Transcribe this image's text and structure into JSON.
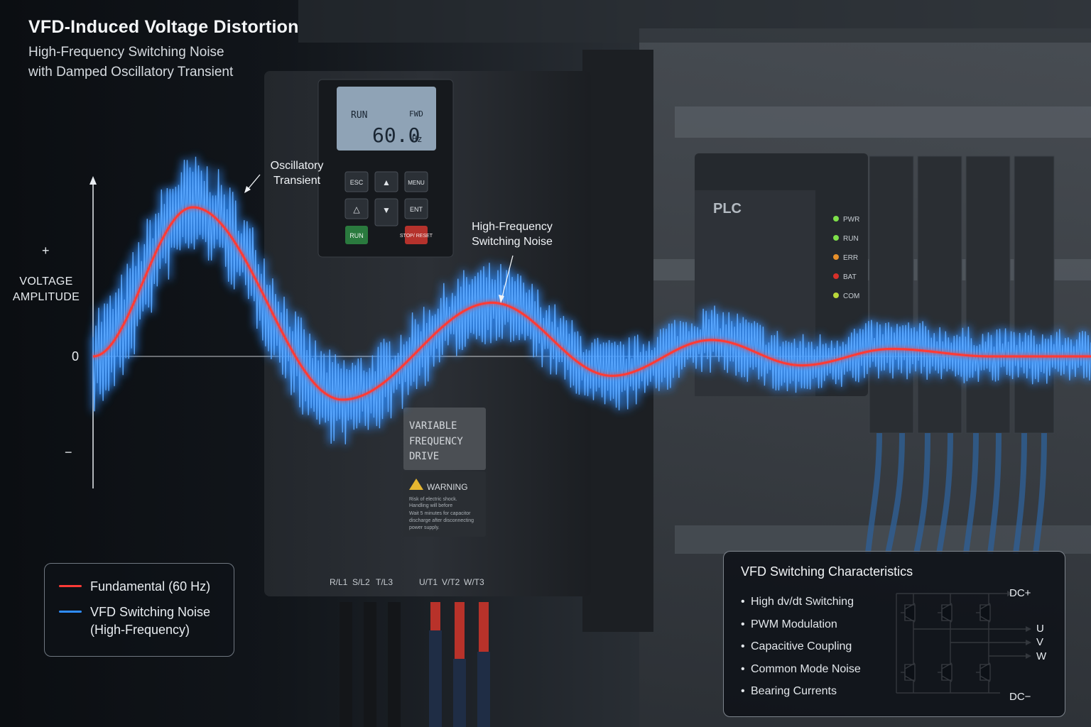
{
  "title": "VFD-Induced Voltage Distortion",
  "subtitle_line1": "High-Frequency Switching Noise",
  "subtitle_line2": "with Damped Oscillatory Transient",
  "colors": {
    "fundamental": "#ff3b36",
    "noise": "#2f8dff",
    "background": "#0c0f13"
  },
  "chart_data": {
    "type": "line",
    "title": "VFD-Induced Voltage Distortion",
    "ylabel_line1": "VOLTAGE",
    "ylabel_line2": "AMPLITUDE",
    "xlabel": "",
    "yticks": [
      "+",
      "0",
      "−"
    ],
    "ylim": [
      -1.3,
      1.3
    ],
    "description_values": {
      "fundamental_peaks": [
        {
          "t": 0.1,
          "v": 1.0
        },
        {
          "t": 0.25,
          "v": -0.29
        },
        {
          "t": 0.4,
          "v": 0.36
        },
        {
          "t": 0.52,
          "v": -0.13
        },
        {
          "t": 0.62,
          "v": 0.11
        },
        {
          "t": 0.71,
          "v": -0.06
        },
        {
          "t": 0.8,
          "v": 0.05
        }
      ]
    },
    "series": [
      {
        "name": "Fundamental (60 Hz)"
      },
      {
        "name": "VFD Switching Noise (High-Frequency)"
      }
    ],
    "legend_position": "bottom-left",
    "grid": false
  },
  "annotations": {
    "transient_line1": "Oscillatory",
    "transient_line2": "Transient",
    "noise_line1": "High-Frequency",
    "noise_line2": "Switching Noise"
  },
  "legend": {
    "item1": "Fundamental (60 Hz)",
    "item2_line1": "VFD Switching Noise",
    "item2_line2": "(High-Frequency)"
  },
  "panel": {
    "title": "VFD Switching Characteristics",
    "items": [
      "High dv/dt Switching",
      "PWM Modulation",
      "Capacitive Coupling",
      "Common Mode Noise",
      "Bearing Currents"
    ],
    "circuit_labels": {
      "dc_plus": "DC+",
      "u": "U",
      "v": "V",
      "w": "W",
      "dc_minus": "DC−"
    }
  },
  "vfd": {
    "display_mode": "RUN",
    "display_dir": "FWD",
    "display_value": "60.0",
    "display_unit": "Hz",
    "keys": [
      "ESC",
      "▲",
      "MENU",
      "△",
      "▼",
      "ENT",
      "RUN",
      "STOP/ RESET"
    ],
    "label_lines": [
      "VARIABLE",
      "FREQUENCY",
      "DRIVE"
    ],
    "warning": "WARNING",
    "warning_body": [
      "Risk of electric shock.",
      "Handling will before",
      "Wait 5 minutes for capacitor",
      "discharge after disconnecting",
      "power supply."
    ],
    "terminals": [
      "R/L1",
      "S/L2",
      "T/L3",
      "U/T1",
      "V/T2",
      "W/T3"
    ]
  },
  "plc": {
    "label": "PLC",
    "leds": [
      {
        "label": "PWR",
        "color": "#7ee04a"
      },
      {
        "label": "RUN",
        "color": "#7ee04a"
      },
      {
        "label": "ERR",
        "color": "#e8902a"
      },
      {
        "label": "BAT",
        "color": "#d8302a"
      },
      {
        "label": "COM",
        "color": "#b9d83a"
      }
    ]
  }
}
